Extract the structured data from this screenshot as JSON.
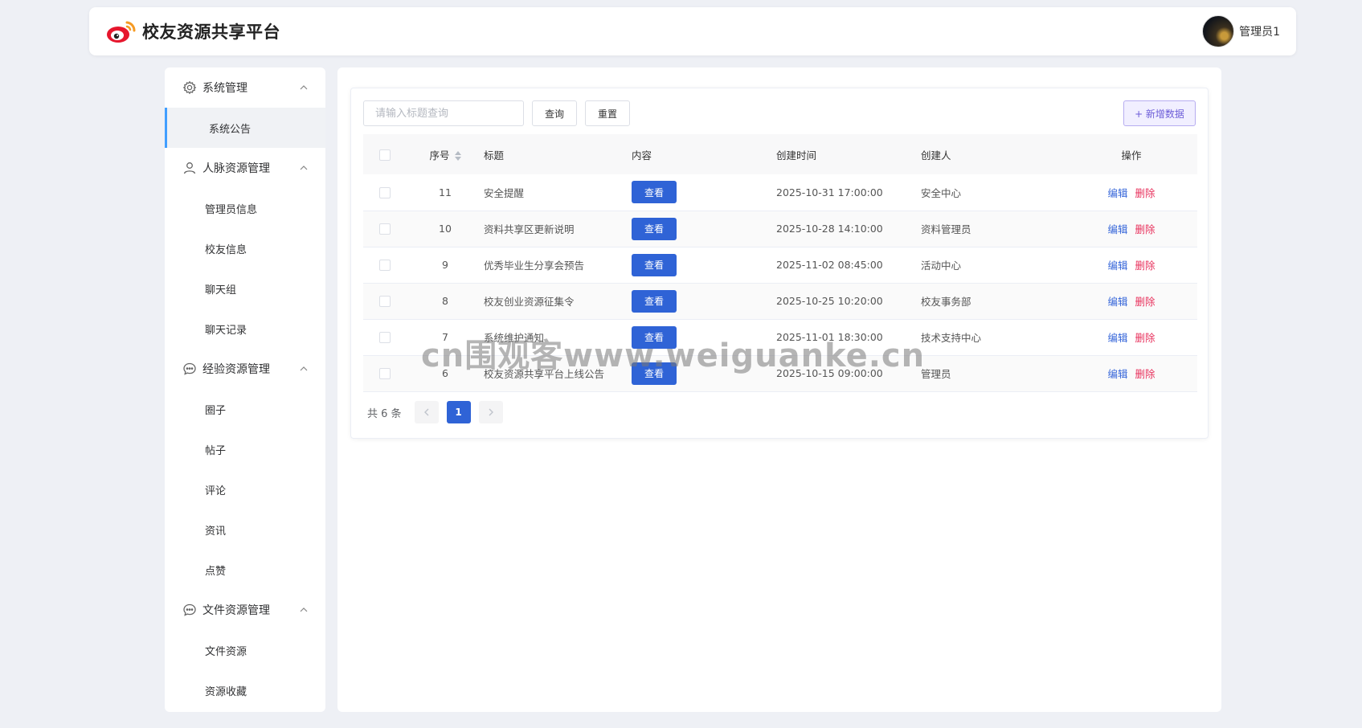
{
  "header": {
    "title": "校友资源共享平台",
    "user_name": "管理员1"
  },
  "sidebar": {
    "groups": [
      {
        "icon": "gear-icon",
        "label": "系统管理",
        "items": [
          "系统公告"
        ]
      },
      {
        "icon": "user-icon",
        "label": "人脉资源管理",
        "items": [
          "管理员信息",
          "校友信息",
          "聊天组",
          "聊天记录"
        ]
      },
      {
        "icon": "chat-bubble-icon",
        "label": "经验资源管理",
        "items": [
          "圈子",
          "帖子",
          "评论",
          "资讯",
          "点赞"
        ]
      },
      {
        "icon": "chat-bubble-icon",
        "label": "文件资源管理",
        "items": [
          "文件资源",
          "资源收藏"
        ]
      }
    ],
    "active_item": "系统公告"
  },
  "toolbar": {
    "search_placeholder": "请输入标题查询",
    "query_label": "查询",
    "reset_label": "重置",
    "add_label": "+ 新增数据"
  },
  "table": {
    "columns": [
      "序号",
      "标题",
      "内容",
      "创建时间",
      "创建人",
      "操作"
    ],
    "view_label": "查看",
    "edit_label": "编辑",
    "delete_label": "删除",
    "rows": [
      {
        "id": "11",
        "title": "安全提醒",
        "time": "2025-10-31 17:00:00",
        "creator": "安全中心"
      },
      {
        "id": "10",
        "title": "资料共享区更新说明",
        "time": "2025-10-28 14:10:00",
        "creator": "资料管理员"
      },
      {
        "id": "9",
        "title": "优秀毕业生分享会预告",
        "time": "2025-11-02 08:45:00",
        "creator": "活动中心"
      },
      {
        "id": "8",
        "title": "校友创业资源征集令",
        "time": "2025-10-25 10:20:00",
        "creator": "校友事务部"
      },
      {
        "id": "7",
        "title": "系统维护通知",
        "time": "2025-11-01 18:30:00",
        "creator": "技术支持中心"
      },
      {
        "id": "6",
        "title": "校友资源共享平台上线公告",
        "time": "2025-10-15 09:00:00",
        "creator": "管理员"
      }
    ]
  },
  "pagination": {
    "total_label": "共 6 条",
    "current_page": "1"
  },
  "colors": {
    "primary": "#2f63d6",
    "edit": "#3666d9",
    "delete": "#e8325d",
    "add_button_text": "#6c5cd8"
  },
  "watermark": "cn围观客www.weiguanke.cn"
}
